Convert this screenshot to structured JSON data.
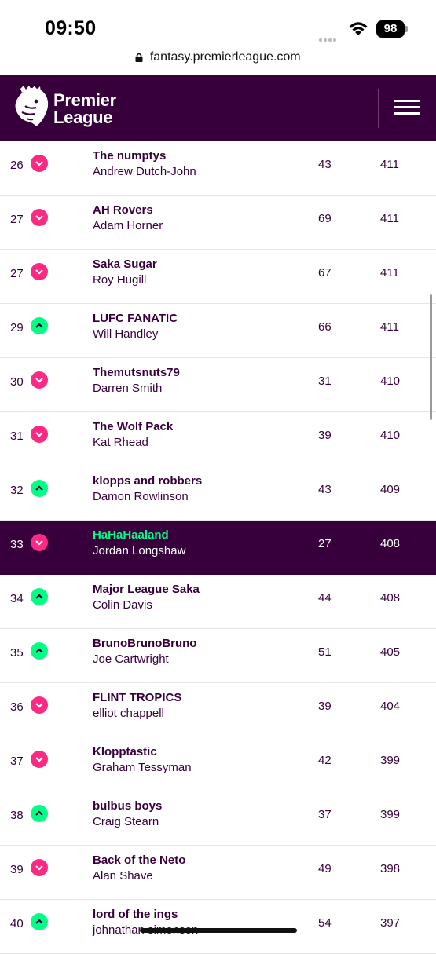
{
  "status": {
    "time": "09:50",
    "battery": "98"
  },
  "url": "fantasy.premierleague.com",
  "brand": {
    "line1": "Premier",
    "line2": "League"
  },
  "rows": [
    {
      "rank": "26",
      "move": "down",
      "team": "The numptys",
      "manager": "Andrew Dutch-John",
      "gw": "43",
      "total": "411"
    },
    {
      "rank": "27",
      "move": "down",
      "team": "AH Rovers",
      "manager": "Adam Horner",
      "gw": "69",
      "total": "411"
    },
    {
      "rank": "27",
      "move": "down",
      "team": "Saka Sugar",
      "manager": "Roy Hugill",
      "gw": "67",
      "total": "411"
    },
    {
      "rank": "29",
      "move": "up",
      "team": "LUFC FANATIC",
      "manager": "Will Handley",
      "gw": "66",
      "total": "411"
    },
    {
      "rank": "30",
      "move": "down",
      "team": "Themutsnuts79",
      "manager": "Darren Smith",
      "gw": "31",
      "total": "410"
    },
    {
      "rank": "31",
      "move": "down",
      "team": "The Wolf Pack",
      "manager": "Kat Rhead",
      "gw": "39",
      "total": "410"
    },
    {
      "rank": "32",
      "move": "up",
      "team": "klopps and robbers",
      "manager": "Damon Rowlinson",
      "gw": "43",
      "total": "409"
    },
    {
      "rank": "33",
      "move": "down",
      "team": "HaHaHaaland",
      "manager": "Jordan Longshaw",
      "gw": "27",
      "total": "408",
      "highlight": true
    },
    {
      "rank": "34",
      "move": "up",
      "team": "Major League Saka",
      "manager": "Colin Davis",
      "gw": "44",
      "total": "408"
    },
    {
      "rank": "35",
      "move": "up",
      "team": "BrunoBrunoBruno",
      "manager": "Joe Cartwright",
      "gw": "51",
      "total": "405"
    },
    {
      "rank": "36",
      "move": "down",
      "team": "FLINT TROPICS",
      "manager": "elliot chappell",
      "gw": "39",
      "total": "404"
    },
    {
      "rank": "37",
      "move": "down",
      "team": "Klopptastic",
      "manager": "Graham Tessyman",
      "gw": "42",
      "total": "399"
    },
    {
      "rank": "38",
      "move": "up",
      "team": "bulbus boys",
      "manager": "Craig Stearn",
      "gw": "37",
      "total": "399"
    },
    {
      "rank": "39",
      "move": "down",
      "team": "Back of the Neto",
      "manager": "Alan Shave",
      "gw": "49",
      "total": "398"
    },
    {
      "rank": "40",
      "move": "up",
      "team": "lord of the ings",
      "manager": "johnathan simonson",
      "gw": "54",
      "total": "397"
    }
  ]
}
